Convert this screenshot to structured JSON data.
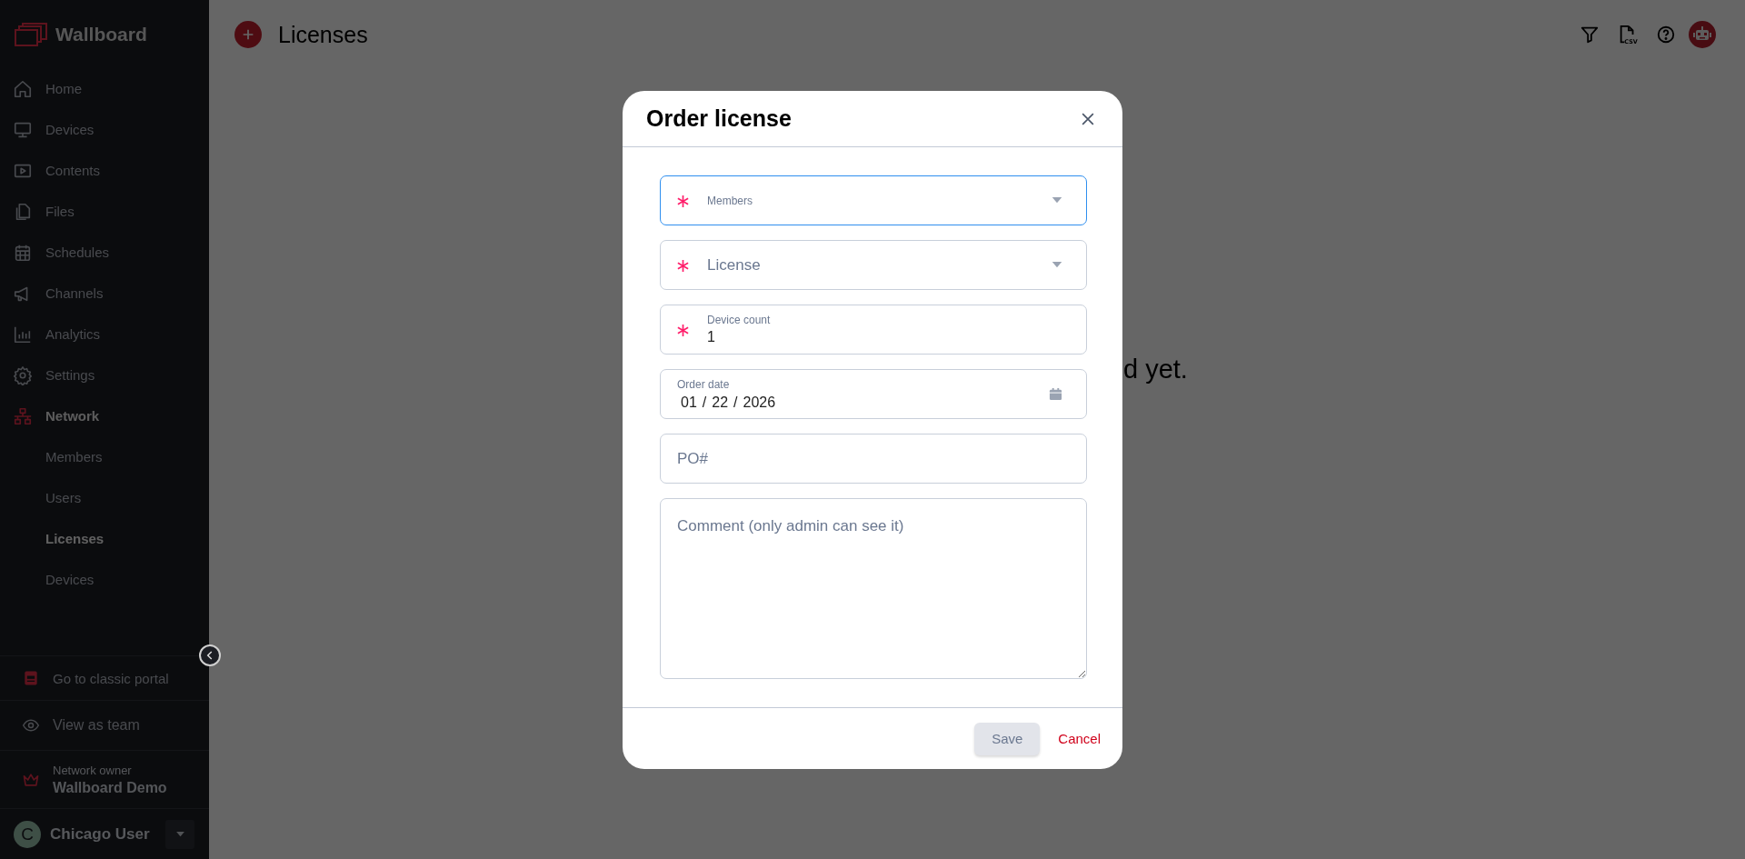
{
  "app": {
    "name": "Wallboard"
  },
  "sidebar": {
    "items": [
      {
        "label": "Home",
        "selected": false
      },
      {
        "label": "Devices",
        "selected": false
      },
      {
        "label": "Contents",
        "selected": false
      },
      {
        "label": "Files",
        "selected": false
      },
      {
        "label": "Schedules",
        "selected": false
      },
      {
        "label": "Channels",
        "selected": false
      },
      {
        "label": "Analytics",
        "selected": false
      },
      {
        "label": "Settings",
        "selected": false
      },
      {
        "label": "Network",
        "selected": true,
        "children": [
          {
            "label": "Members",
            "selected": false
          },
          {
            "label": "Users",
            "selected": false
          },
          {
            "label": "Licenses",
            "selected": true
          },
          {
            "label": "Devices",
            "selected": false
          }
        ]
      }
    ],
    "footer_links": [
      {
        "label": "Go to classic portal"
      },
      {
        "label": "View as team"
      }
    ],
    "network_owner": {
      "caption": "Network owner",
      "name": "Wallboard Demo"
    },
    "user": {
      "initial": "C",
      "name": "Chicago User"
    }
  },
  "page": {
    "title": "Licenses",
    "empty_message": "d yet."
  },
  "toolbar": {
    "csv_label": "CSV"
  },
  "dialog": {
    "title": "Order license",
    "fields": [
      {
        "kind": "select",
        "label": "Members",
        "required": true,
        "focused": true
      },
      {
        "kind": "select",
        "label": "License",
        "required": true,
        "focused": false
      },
      {
        "kind": "number",
        "label": "Device count",
        "value": "1",
        "required": true,
        "focused": false
      },
      {
        "kind": "date",
        "label": "Order date",
        "segments": [
          "01",
          "/",
          "22",
          "/",
          "2026"
        ],
        "required": false,
        "focused": false
      },
      {
        "kind": "text",
        "placeholder": "PO#"
      },
      {
        "kind": "textarea",
        "placeholder": "Comment (only admin can see it)"
      }
    ],
    "buttons": [
      {
        "label": "Save",
        "kind": "primary",
        "disabled": true
      },
      {
        "label": "Cancel",
        "kind": "link",
        "disabled": false
      }
    ]
  }
}
